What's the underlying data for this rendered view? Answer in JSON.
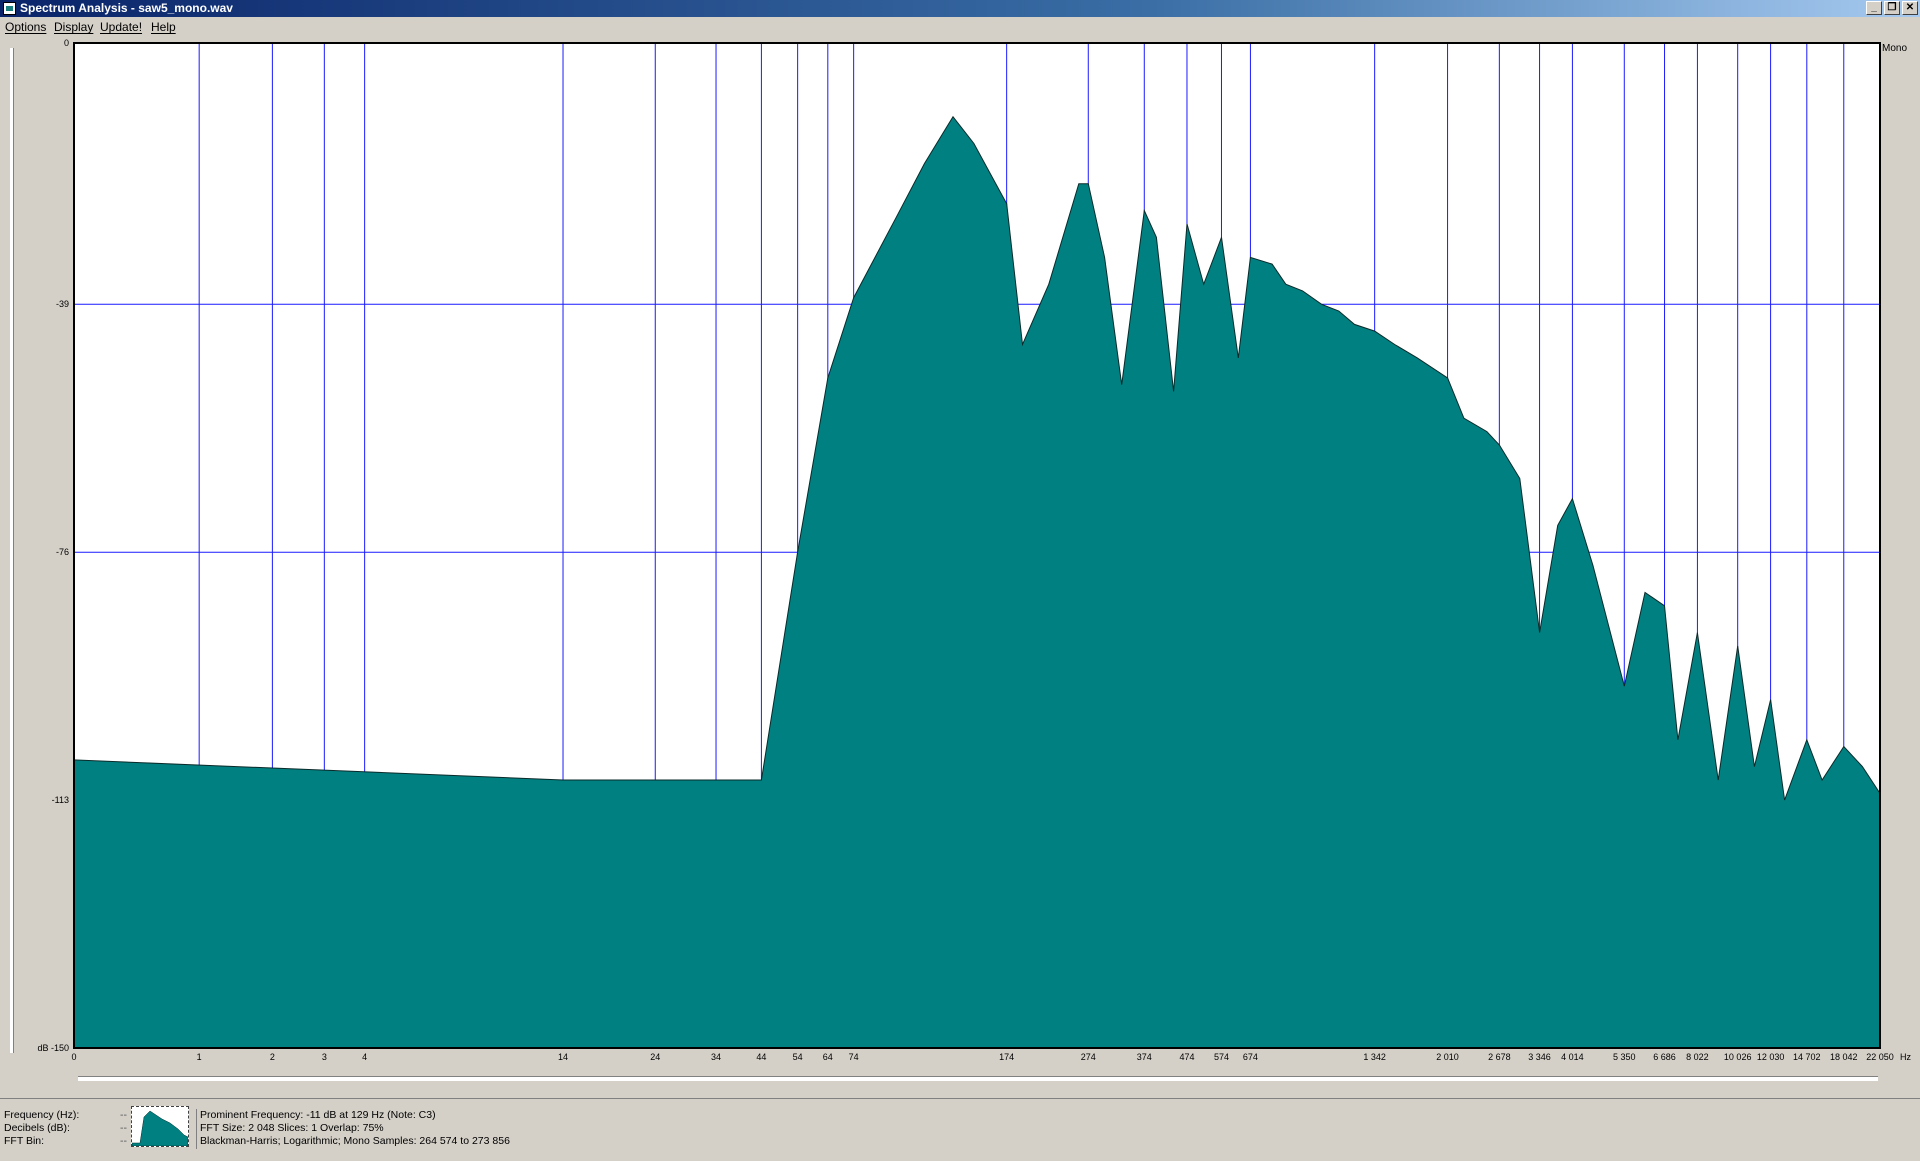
{
  "window": {
    "title": "Spectrum Analysis - saw5_mono.wav",
    "controls": [
      "_",
      "❐",
      "✕"
    ]
  },
  "menu": [
    {
      "label": "Options"
    },
    {
      "label": "Display"
    },
    {
      "label": "Update!"
    },
    {
      "label": "Help"
    }
  ],
  "graph": {
    "channel_label": "Mono",
    "hz_unit": "Hz",
    "db_unit": "dB"
  },
  "chart_data": {
    "type": "area",
    "fill_color": "#008080",
    "grid_color": "#1a1aff",
    "x_scale": "log",
    "xlim": [
      0,
      22050
    ],
    "ylim": [
      -150,
      0
    ],
    "y_ticks": [
      "0",
      "-39",
      "-76",
      "-113",
      "-150"
    ],
    "x_ticks": [
      "0",
      "1",
      "2",
      "3",
      "4",
      "14",
      "24",
      "34",
      "44",
      "54",
      "64",
      "74",
      "174",
      "274",
      "374",
      "474",
      "574",
      "674",
      "1 342",
      "2 010",
      "2 678",
      "3 346",
      "4 014",
      "5 350",
      "6 686",
      "8 022",
      "10 026",
      "12 030",
      "14 702",
      "18 042",
      "22 050"
    ],
    "x": [
      0,
      14,
      24,
      34,
      44,
      54,
      64,
      74,
      94,
      110,
      129,
      145,
      174,
      190,
      220,
      260,
      274,
      300,
      330,
      374,
      400,
      440,
      474,
      520,
      574,
      630,
      674,
      760,
      820,
      900,
      1000,
      1100,
      1200,
      1342,
      1500,
      1700,
      2010,
      2200,
      2500,
      2678,
      3000,
      3346,
      3700,
      4014,
      4500,
      5350,
      6000,
      6686,
      7200,
      8022,
      9000,
      10026,
      11000,
      12030,
      13000,
      14702,
      16000,
      18042,
      20000,
      22050
    ],
    "y": [
      -107,
      -110,
      -110,
      -110,
      -110,
      -76,
      -50,
      -38,
      -26,
      -18,
      -11,
      -15,
      -24,
      -45,
      -36,
      -21,
      -21,
      -32,
      -51,
      -25,
      -29,
      -52,
      -27,
      -36,
      -29,
      -47,
      -32,
      -33,
      -36,
      -37,
      -39,
      -40,
      -42,
      -43,
      -45,
      -47,
      -50,
      -56,
      -58,
      -60,
      -65,
      -88,
      -72,
      -68,
      -78,
      -96,
      -82,
      -84,
      -104,
      -88,
      -110,
      -90,
      -108,
      -98,
      -113,
      -104,
      -110,
      -105,
      -108,
      -112
    ]
  },
  "status": {
    "labels": [
      "Frequency (Hz):",
      "Decibels (dB):",
      "FFT Bin:"
    ],
    "dashes": [
      "--",
      "--",
      "--"
    ],
    "info": [
      "Prominent Frequency: -11 dB at 129 Hz (Note: C3)",
      "FFT Size: 2 048  Slices: 1  Overlap: 75%",
      "Blackman-Harris; Logarithmic; Mono  Samples: 264 574 to 273 856"
    ]
  }
}
